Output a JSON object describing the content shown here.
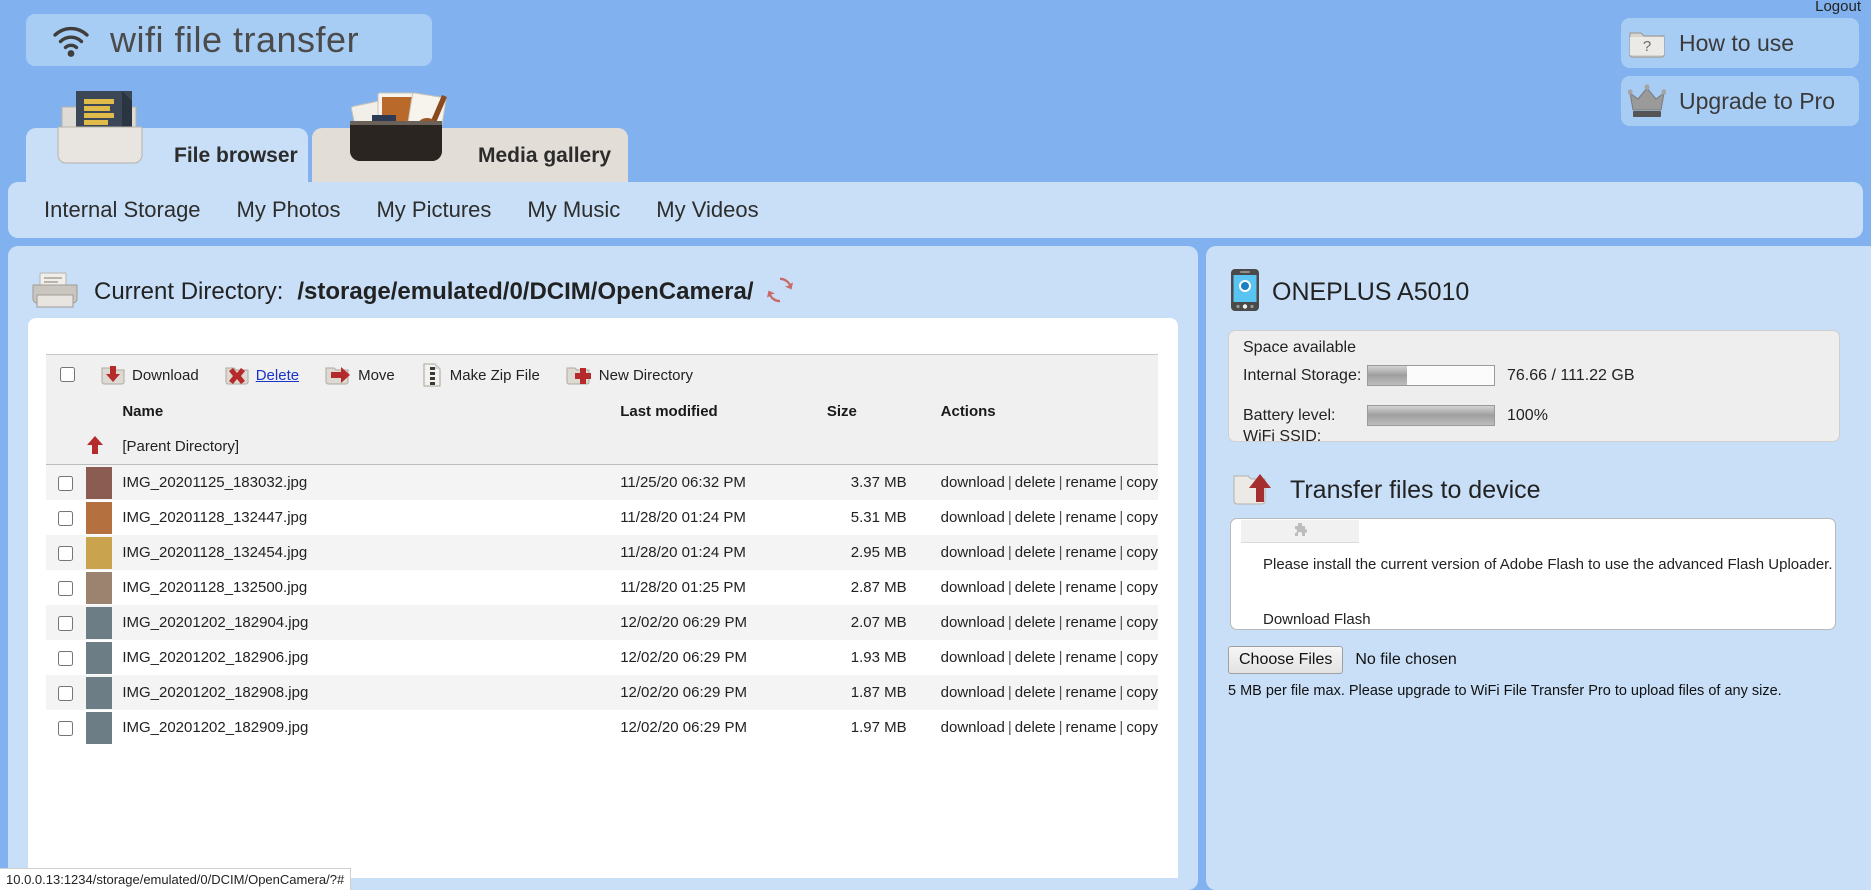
{
  "header": {
    "logout_label": "Logout",
    "app_title": "wifi file transfer",
    "how_to_use_label": "How to use",
    "upgrade_label": "Upgrade to Pro",
    "wifi_icon": "wifi-icon",
    "help_icon": "help-folder-icon",
    "crown_icon": "crown-icon"
  },
  "tabs": [
    {
      "label": "File browser",
      "active": true
    },
    {
      "label": "Media gallery",
      "active": false
    }
  ],
  "nav": {
    "items": [
      {
        "label": "Internal Storage"
      },
      {
        "label": "My Photos"
      },
      {
        "label": "My Pictures"
      },
      {
        "label": "My Music"
      },
      {
        "label": "My Videos"
      }
    ]
  },
  "directory": {
    "label": "Current Directory:",
    "path": "/storage/emulated/0/DCIM/OpenCamera/",
    "folder_icon": "folder-icon",
    "refresh_icon": "refresh-icon"
  },
  "toolbar": {
    "download_label": "Download",
    "delete_label": "Delete",
    "move_label": "Move",
    "zip_label": "Make Zip File",
    "newdir_label": "New Directory"
  },
  "table": {
    "columns": {
      "name": "Name",
      "modified": "Last modified",
      "size": "Size",
      "actions": "Actions"
    },
    "parent_label": "[Parent Directory]",
    "actions": {
      "download": "download",
      "delete": "delete",
      "rename": "rename",
      "copy": "copy",
      "separator": "|"
    },
    "rows": [
      {
        "name": "IMG_20201125_183032.jpg",
        "modified": "11/25/20 06:32 PM",
        "size": "3.37 MB",
        "thumb": "#8a5c52"
      },
      {
        "name": "IMG_20201128_132447.jpg",
        "modified": "11/28/20 01:24 PM",
        "size": "5.31 MB",
        "thumb": "#b4713f"
      },
      {
        "name": "IMG_20201128_132454.jpg",
        "modified": "11/28/20 01:24 PM",
        "size": "2.95 MB",
        "thumb": "#c9a34e"
      },
      {
        "name": "IMG_20201128_132500.jpg",
        "modified": "11/28/20 01:25 PM",
        "size": "2.87 MB",
        "thumb": "#9c8370"
      },
      {
        "name": "IMG_20201202_182904.jpg",
        "modified": "12/02/20 06:29 PM",
        "size": "2.07 MB",
        "thumb": "#6d7d86"
      },
      {
        "name": "IMG_20201202_182906.jpg",
        "modified": "12/02/20 06:29 PM",
        "size": "1.93 MB",
        "thumb": "#6d7d86"
      },
      {
        "name": "IMG_20201202_182908.jpg",
        "modified": "12/02/20 06:29 PM",
        "size": "1.87 MB",
        "thumb": "#6d7d86"
      },
      {
        "name": "IMG_20201202_182909.jpg",
        "modified": "12/02/20 06:29 PM",
        "size": "1.97 MB",
        "thumb": "#6d7d86"
      }
    ]
  },
  "device": {
    "name": "ONEPLUS A5010",
    "phone_icon": "phone-icon",
    "space_title": "Space available",
    "storage_label": "Internal Storage:",
    "storage_value": "76.66 / 111.22 GB",
    "storage_percent": 31,
    "battery_label": "Battery level:",
    "battery_value": "100%",
    "battery_percent": 100,
    "ssid_label": "WiFi SSID:"
  },
  "transfer": {
    "title": "Transfer files to device",
    "upload_icon": "upload-folder-icon",
    "flash_icon": "puzzle-piece-icon",
    "flash_message": "Please install the current version of Adobe Flash to use the advanced Flash Uploader.",
    "download_flash_label": "Download Flash",
    "choose_files_label": "Choose Files",
    "no_file_label": "No file chosen",
    "max_note": "5 MB per file max. Please upgrade to WiFi File Transfer Pro to upload files of any size."
  },
  "status_bar": {
    "text": "10.0.0.13:1234/storage/emulated/0/DCIM/OpenCamera/?#"
  }
}
